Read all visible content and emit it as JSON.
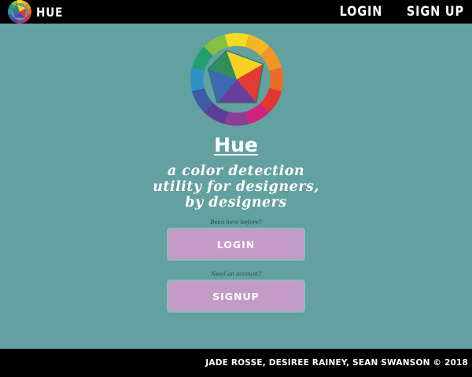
{
  "navbar": {
    "brand_name": "HUE",
    "links": [
      "LOGIN",
      "SIGN UP"
    ]
  },
  "hero": {
    "title": "Hue",
    "tagline": [
      "a color detection",
      "utility for designers,",
      "by designers"
    ]
  },
  "auth": {
    "login_prompt": "Been here before?",
    "login_label": "LOGIN",
    "signup_prompt": "Need an account?",
    "signup_label": "SIGNUP"
  },
  "footer": {
    "credits": "JADE ROSSE, DESIREE RAINEY, SEAN SWANSON © 2018"
  },
  "colors": {
    "background": "#63a0a0",
    "bar": "#000000",
    "button": "#c49bc7",
    "text": "#ffffff"
  },
  "icons": {
    "logo": "color-wheel-icon"
  }
}
